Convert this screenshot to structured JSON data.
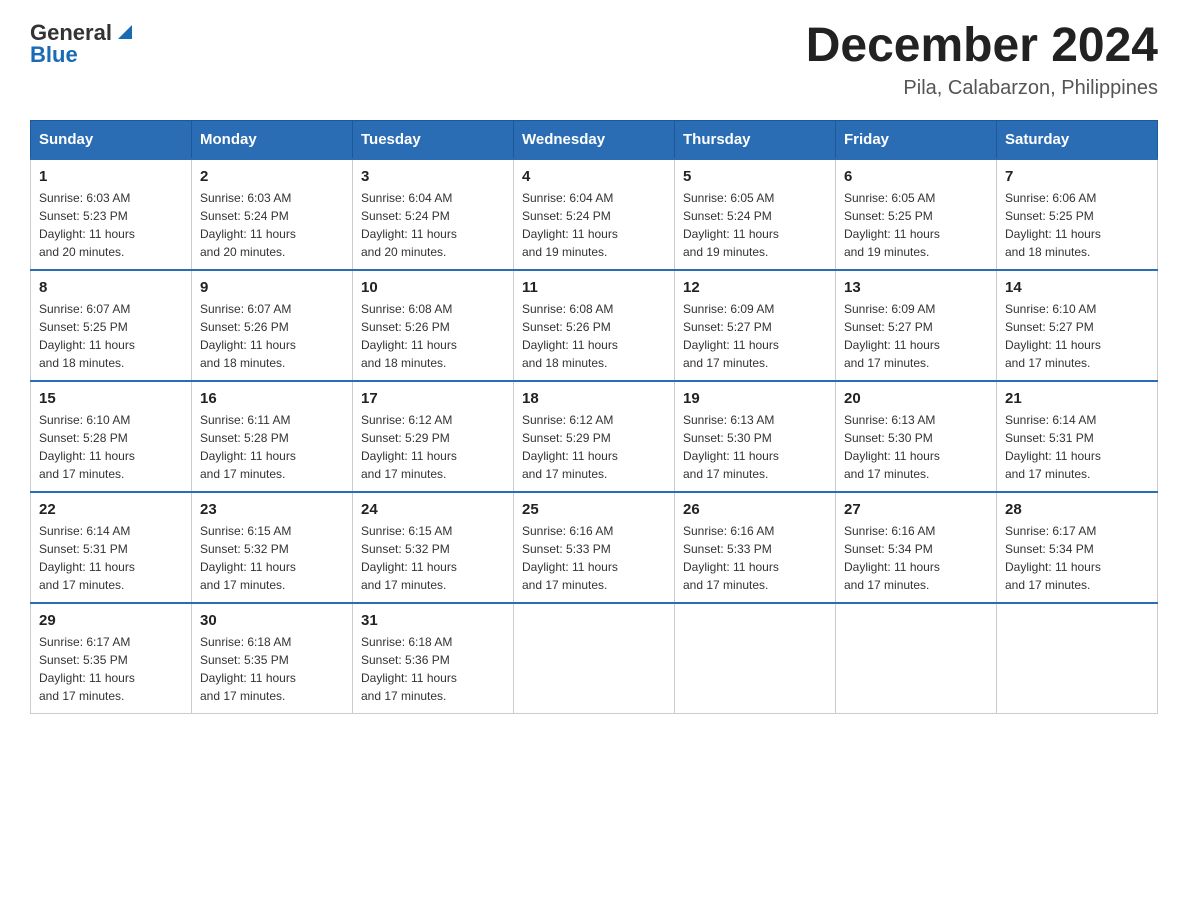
{
  "header": {
    "logo": {
      "general": "General",
      "blue": "Blue"
    },
    "title": "December 2024",
    "subtitle": "Pila, Calabarzon, Philippines"
  },
  "weekdays": [
    "Sunday",
    "Monday",
    "Tuesday",
    "Wednesday",
    "Thursday",
    "Friday",
    "Saturday"
  ],
  "weeks": [
    [
      {
        "day": "1",
        "sunrise": "6:03 AM",
        "sunset": "5:23 PM",
        "daylight": "11 hours and 20 minutes."
      },
      {
        "day": "2",
        "sunrise": "6:03 AM",
        "sunset": "5:24 PM",
        "daylight": "11 hours and 20 minutes."
      },
      {
        "day": "3",
        "sunrise": "6:04 AM",
        "sunset": "5:24 PM",
        "daylight": "11 hours and 20 minutes."
      },
      {
        "day": "4",
        "sunrise": "6:04 AM",
        "sunset": "5:24 PM",
        "daylight": "11 hours and 19 minutes."
      },
      {
        "day": "5",
        "sunrise": "6:05 AM",
        "sunset": "5:24 PM",
        "daylight": "11 hours and 19 minutes."
      },
      {
        "day": "6",
        "sunrise": "6:05 AM",
        "sunset": "5:25 PM",
        "daylight": "11 hours and 19 minutes."
      },
      {
        "day": "7",
        "sunrise": "6:06 AM",
        "sunset": "5:25 PM",
        "daylight": "11 hours and 18 minutes."
      }
    ],
    [
      {
        "day": "8",
        "sunrise": "6:07 AM",
        "sunset": "5:25 PM",
        "daylight": "11 hours and 18 minutes."
      },
      {
        "day": "9",
        "sunrise": "6:07 AM",
        "sunset": "5:26 PM",
        "daylight": "11 hours and 18 minutes."
      },
      {
        "day": "10",
        "sunrise": "6:08 AM",
        "sunset": "5:26 PM",
        "daylight": "11 hours and 18 minutes."
      },
      {
        "day": "11",
        "sunrise": "6:08 AM",
        "sunset": "5:26 PM",
        "daylight": "11 hours and 18 minutes."
      },
      {
        "day": "12",
        "sunrise": "6:09 AM",
        "sunset": "5:27 PM",
        "daylight": "11 hours and 17 minutes."
      },
      {
        "day": "13",
        "sunrise": "6:09 AM",
        "sunset": "5:27 PM",
        "daylight": "11 hours and 17 minutes."
      },
      {
        "day": "14",
        "sunrise": "6:10 AM",
        "sunset": "5:27 PM",
        "daylight": "11 hours and 17 minutes."
      }
    ],
    [
      {
        "day": "15",
        "sunrise": "6:10 AM",
        "sunset": "5:28 PM",
        "daylight": "11 hours and 17 minutes."
      },
      {
        "day": "16",
        "sunrise": "6:11 AM",
        "sunset": "5:28 PM",
        "daylight": "11 hours and 17 minutes."
      },
      {
        "day": "17",
        "sunrise": "6:12 AM",
        "sunset": "5:29 PM",
        "daylight": "11 hours and 17 minutes."
      },
      {
        "day": "18",
        "sunrise": "6:12 AM",
        "sunset": "5:29 PM",
        "daylight": "11 hours and 17 minutes."
      },
      {
        "day": "19",
        "sunrise": "6:13 AM",
        "sunset": "5:30 PM",
        "daylight": "11 hours and 17 minutes."
      },
      {
        "day": "20",
        "sunrise": "6:13 AM",
        "sunset": "5:30 PM",
        "daylight": "11 hours and 17 minutes."
      },
      {
        "day": "21",
        "sunrise": "6:14 AM",
        "sunset": "5:31 PM",
        "daylight": "11 hours and 17 minutes."
      }
    ],
    [
      {
        "day": "22",
        "sunrise": "6:14 AM",
        "sunset": "5:31 PM",
        "daylight": "11 hours and 17 minutes."
      },
      {
        "day": "23",
        "sunrise": "6:15 AM",
        "sunset": "5:32 PM",
        "daylight": "11 hours and 17 minutes."
      },
      {
        "day": "24",
        "sunrise": "6:15 AM",
        "sunset": "5:32 PM",
        "daylight": "11 hours and 17 minutes."
      },
      {
        "day": "25",
        "sunrise": "6:16 AM",
        "sunset": "5:33 PM",
        "daylight": "11 hours and 17 minutes."
      },
      {
        "day": "26",
        "sunrise": "6:16 AM",
        "sunset": "5:33 PM",
        "daylight": "11 hours and 17 minutes."
      },
      {
        "day": "27",
        "sunrise": "6:16 AM",
        "sunset": "5:34 PM",
        "daylight": "11 hours and 17 minutes."
      },
      {
        "day": "28",
        "sunrise": "6:17 AM",
        "sunset": "5:34 PM",
        "daylight": "11 hours and 17 minutes."
      }
    ],
    [
      {
        "day": "29",
        "sunrise": "6:17 AM",
        "sunset": "5:35 PM",
        "daylight": "11 hours and 17 minutes."
      },
      {
        "day": "30",
        "sunrise": "6:18 AM",
        "sunset": "5:35 PM",
        "daylight": "11 hours and 17 minutes."
      },
      {
        "day": "31",
        "sunrise": "6:18 AM",
        "sunset": "5:36 PM",
        "daylight": "11 hours and 17 minutes."
      },
      null,
      null,
      null,
      null
    ]
  ],
  "labels": {
    "sunrise": "Sunrise:",
    "sunset": "Sunset:",
    "daylight": "Daylight:"
  }
}
